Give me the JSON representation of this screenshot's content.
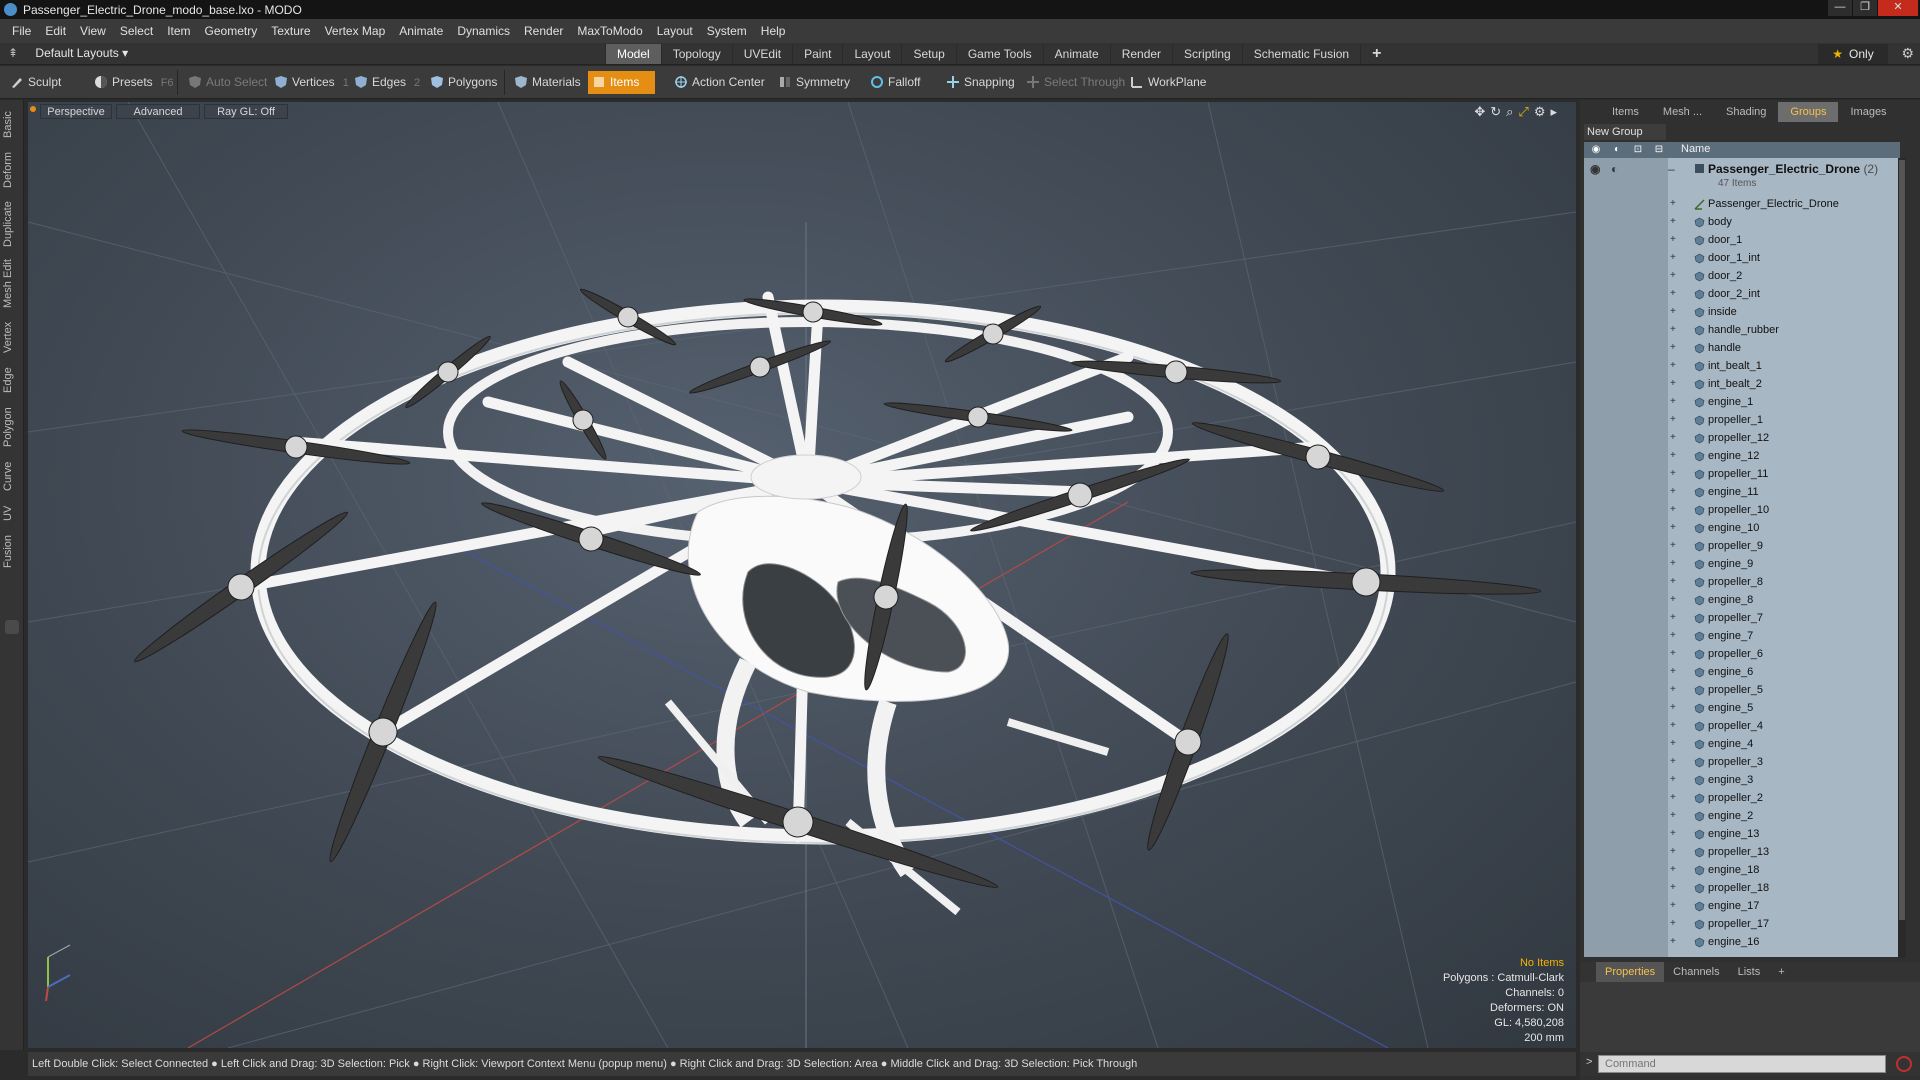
{
  "window": {
    "title": "Passenger_Electric_Drone_modo_base.lxo - MODO",
    "controls": [
      "—",
      "❐",
      "✕"
    ]
  },
  "menu": [
    "File",
    "Edit",
    "View",
    "Select",
    "Item",
    "Geometry",
    "Texture",
    "Vertex Map",
    "Animate",
    "Dynamics",
    "Render",
    "MaxToModo",
    "Layout",
    "System",
    "Help"
  ],
  "layout_bar": {
    "layout_label": "Default Layouts ▾",
    "tabs": [
      "Model",
      "Topology",
      "UVEdit",
      "Paint",
      "Layout",
      "Setup",
      "Game Tools",
      "Animate",
      "Render",
      "Scripting",
      "Schematic Fusion",
      "+"
    ],
    "active_tab": "Model",
    "only_label": "Only"
  },
  "toolbar": {
    "sculpt": "Sculpt",
    "presets": "Presets",
    "presets_shortcut": "F6",
    "auto_select": "Auto Select",
    "vertices": "Vertices",
    "vertices_count": "1",
    "edges": "Edges",
    "edges_count": "2",
    "polygons": "Polygons",
    "materials": "Materials",
    "items": "Items",
    "action_center": "Action Center",
    "symmetry": "Symmetry",
    "falloff": "Falloff",
    "snapping": "Snapping",
    "select_through": "Select Through",
    "workplane": "WorkPlane"
  },
  "left_tabs": [
    "Basic",
    "Deform",
    "Duplicate",
    "Mesh Edit",
    "Vertex",
    "Edge",
    "Polygon",
    "Curve",
    "UV",
    "Fusion"
  ],
  "viewport": {
    "view": "Perspective",
    "shading": "Advanced",
    "raygl": "Ray GL: Off",
    "hud": {
      "items": "No Items",
      "polygons": "Polygons : Catmull-Clark",
      "channels": "Channels: 0",
      "deformers": "Deformers: ON",
      "gl": "GL: 4,580,208",
      "scale": "200 mm"
    }
  },
  "status_bar": "Left Double Click: Select Connected ● Left Click and Drag: 3D Selection: Pick ● Right Click: Viewport Context Menu (popup menu) ● Right Click and Drag: 3D Selection: Area ● Middle Click and Drag: 3D Selection: Pick Through",
  "right_panel": {
    "tabs": [
      "Items",
      "Mesh ...",
      "Shading",
      "Groups",
      "Images"
    ],
    "active_tab": "Groups",
    "new_group": "New Group",
    "name_header": "Name",
    "root": {
      "name": "Passenger_Electric_Drone",
      "count": "(2)",
      "sub": "47 Items"
    },
    "items": [
      "Passenger_Electric_Drone",
      "body",
      "door_1",
      "door_1_int",
      "door_2",
      "door_2_int",
      "inside",
      "handle_rubber",
      "handle",
      "int_bealt_1",
      "int_bealt_2",
      "engine_1",
      "propeller_1",
      "propeller_12",
      "engine_12",
      "propeller_11",
      "engine_11",
      "propeller_10",
      "engine_10",
      "propeller_9",
      "engine_9",
      "propeller_8",
      "engine_8",
      "propeller_7",
      "engine_7",
      "propeller_6",
      "engine_6",
      "propeller_5",
      "engine_5",
      "propeller_4",
      "engine_4",
      "propeller_3",
      "engine_3",
      "propeller_2",
      "engine_2",
      "engine_13",
      "propeller_13",
      "engine_18",
      "propeller_18",
      "engine_17",
      "propeller_17",
      "engine_16"
    ],
    "bottom_tabs": [
      "Properties",
      "Channels",
      "Lists",
      "+"
    ],
    "active_bottom_tab": "Properties",
    "command_placeholder": "Command"
  },
  "colors": {
    "accent": "#e48f14",
    "active_text": "#f6c14b",
    "tree_bg": "#a8b7c4"
  }
}
